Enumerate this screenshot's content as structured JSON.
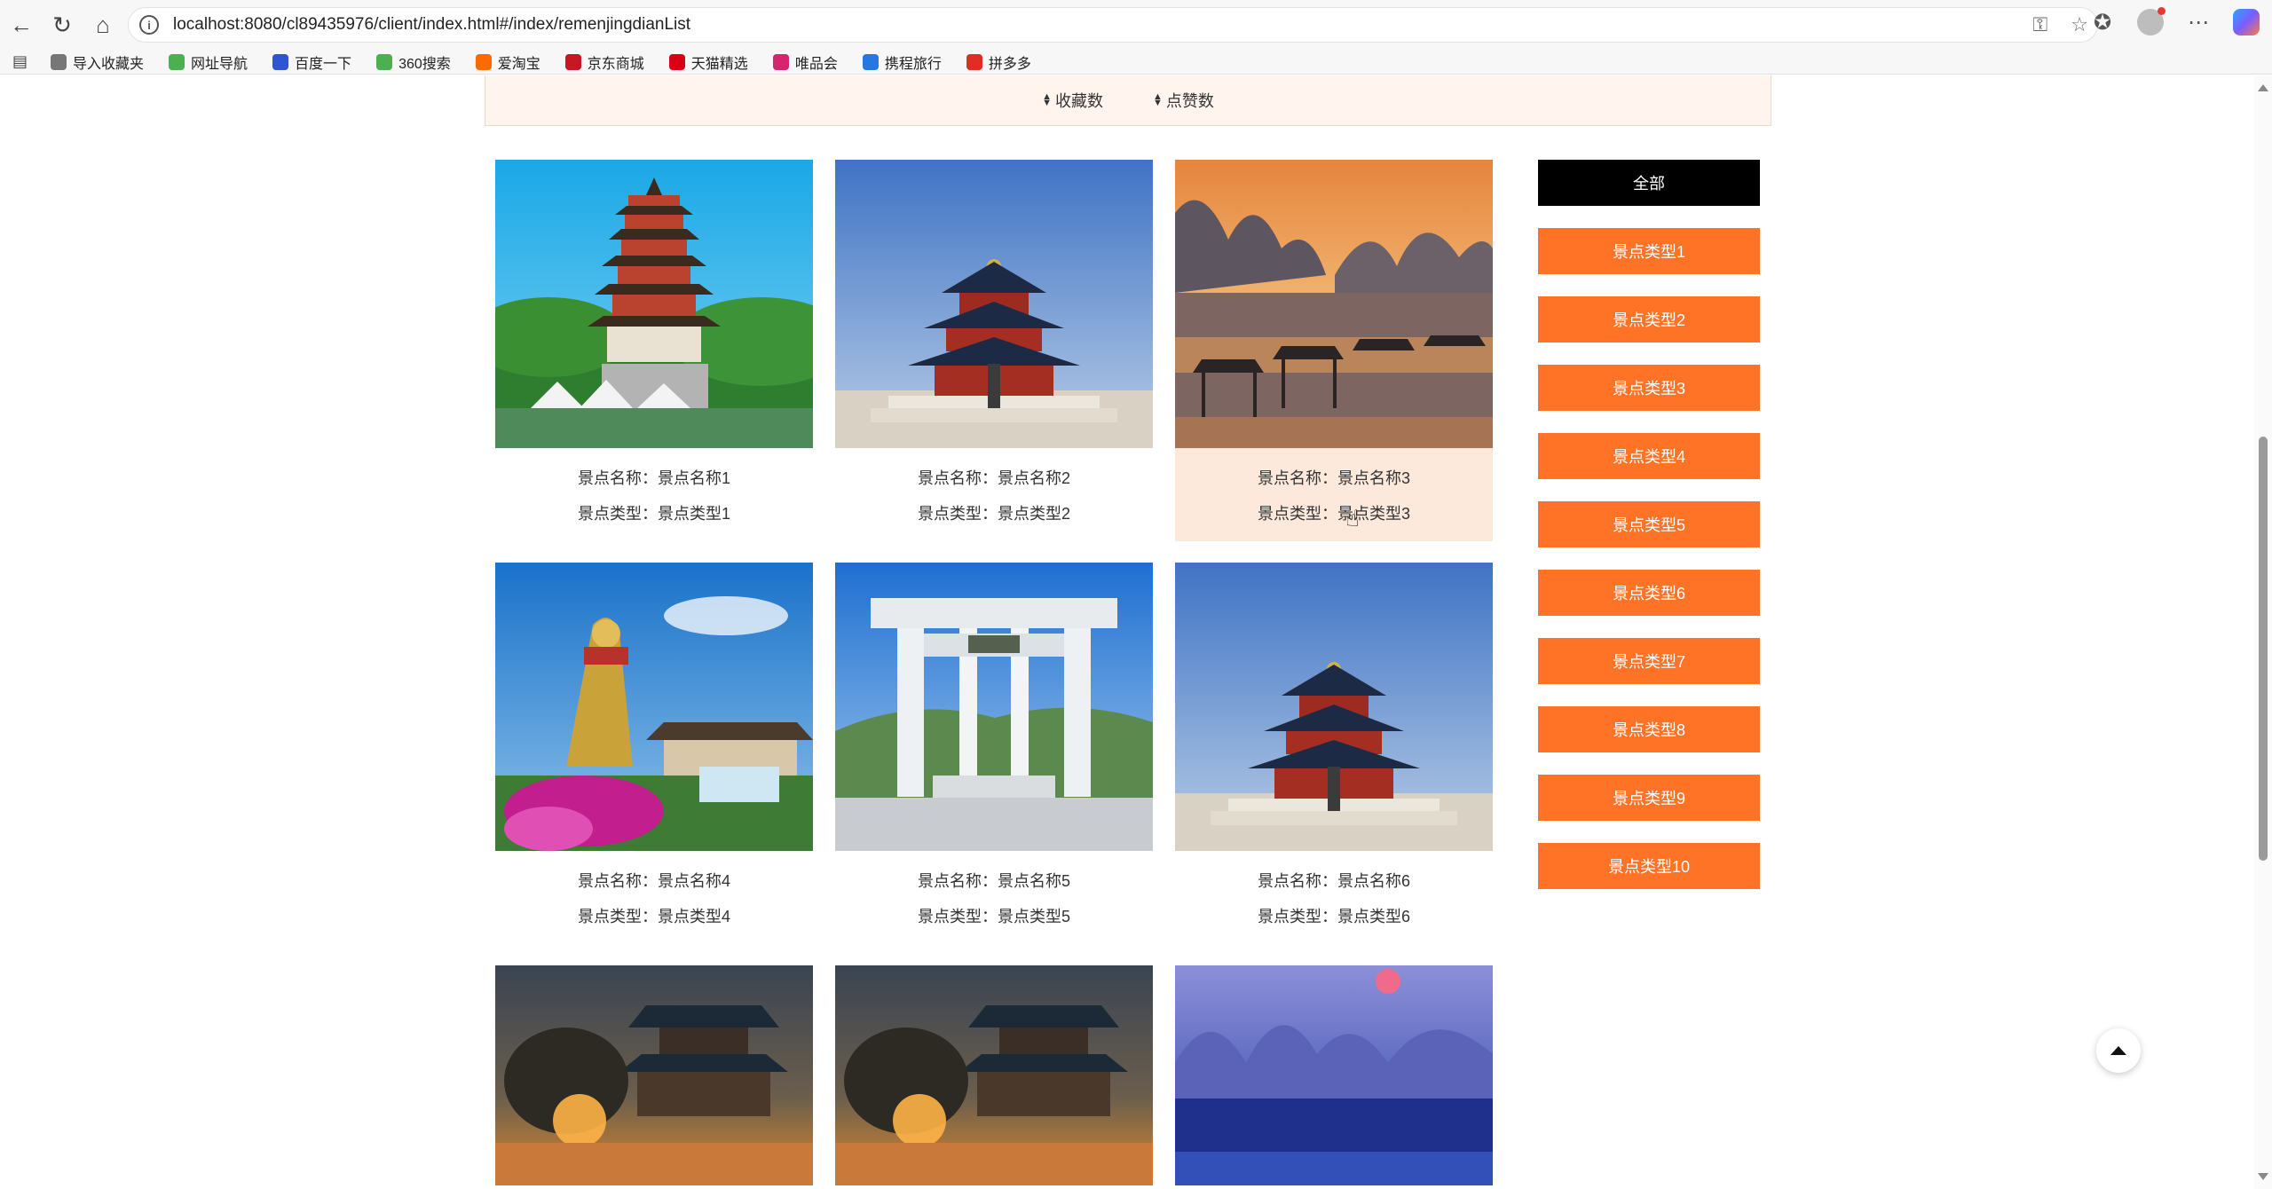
{
  "browser": {
    "url": "localhost:8080/cl89435976/client/index.html#/index/remenjingdianList",
    "bookmarks": [
      {
        "label": "导入收藏夹",
        "icon": "folder-import-icon",
        "color": "#777777"
      },
      {
        "label": "网址导航",
        "icon": "nav-logo-icon",
        "color": "#4caf50"
      },
      {
        "label": "百度一下",
        "icon": "baidu-icon",
        "color": "#2f55d4"
      },
      {
        "label": "360搜索",
        "icon": "360-search-icon",
        "color": "#4caf50"
      },
      {
        "label": "爱淘宝",
        "icon": "taobao-icon",
        "color": "#ff6a00"
      },
      {
        "label": "京东商城",
        "icon": "jd-icon",
        "color": "#c81623"
      },
      {
        "label": "天猫精选",
        "icon": "tmall-icon",
        "color": "#d90014"
      },
      {
        "label": "唯品会",
        "icon": "vip-icon",
        "color": "#d6246e"
      },
      {
        "label": "携程旅行",
        "icon": "ctrip-icon",
        "color": "#2577e3"
      },
      {
        "label": "拼多多",
        "icon": "pinduoduo-icon",
        "color": "#e02e24"
      }
    ]
  },
  "sort": {
    "favorites": "收藏数",
    "likes": "点赞数"
  },
  "cards": [
    {
      "name_label": "景点名称：",
      "name": "景点名称1",
      "type_label": "景点类型：",
      "type": "景点类型1"
    },
    {
      "name_label": "景点名称：",
      "name": "景点名称2",
      "type_label": "景点类型：",
      "type": "景点类型2"
    },
    {
      "name_label": "景点名称：",
      "name": "景点名称3",
      "type_label": "景点类型：",
      "type": "景点类型3"
    },
    {
      "name_label": "景点名称：",
      "name": "景点名称4",
      "type_label": "景点类型：",
      "type": "景点类型4"
    },
    {
      "name_label": "景点名称：",
      "name": "景点名称5",
      "type_label": "景点类型：",
      "type": "景点类型5"
    },
    {
      "name_label": "景点名称：",
      "name": "景点名称6",
      "type_label": "景点类型：",
      "type": "景点类型6"
    }
  ],
  "categories": {
    "all": "全部",
    "items": [
      "景点类型1",
      "景点类型2",
      "景点类型3",
      "景点类型4",
      "景点类型5",
      "景点类型6",
      "景点类型7",
      "景点类型8",
      "景点类型9",
      "景点类型10"
    ]
  },
  "colors": {
    "accent": "#ff7326",
    "active": "#000000",
    "hover_bg": "#fde9dc"
  }
}
